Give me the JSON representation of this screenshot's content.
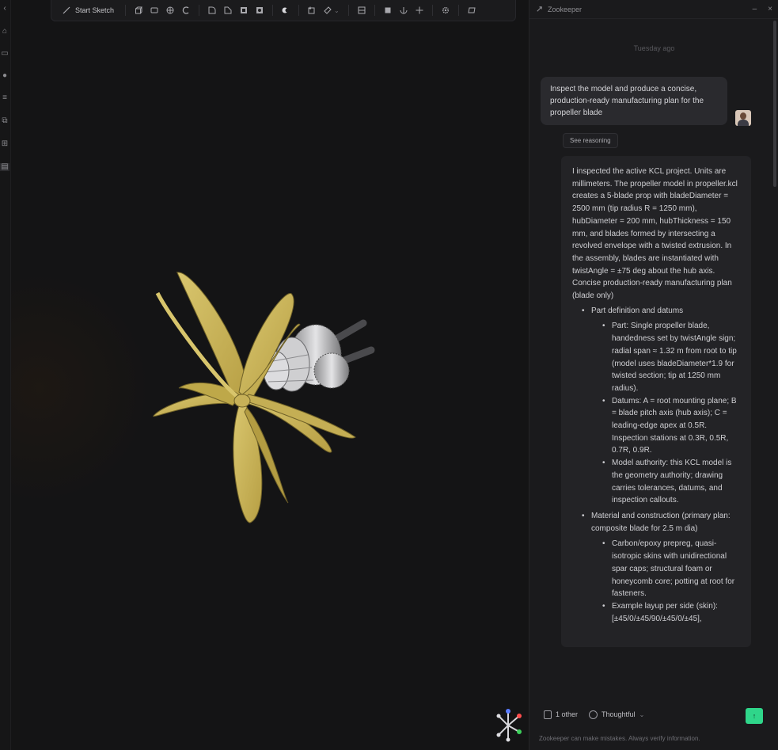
{
  "toolbar": {
    "sketch_label": "Start Sketch",
    "icons": [
      "sketch-icon",
      "extrude-icon",
      "revolve-icon",
      "sweep-icon",
      "loft-icon",
      "fillet-icon",
      "chamfer-icon",
      "shell-icon",
      "hole-icon",
      "boolean-icon",
      "plane-icon",
      "measure-icon",
      "section-icon",
      "cube-icon",
      "sphere-icon",
      "move-icon",
      "settings-icon",
      "view-icon"
    ]
  },
  "panel": {
    "title": "Zookeeper",
    "timestamp": "Tuesday ago",
    "user_message": "Inspect the model and produce a concise, production-ready manufacturing plan for the propeller blade",
    "reasoning_button": "See reasoning",
    "assistant": {
      "intro": "I inspected the active KCL project. Units are millimeters. The propeller model in propeller.kcl creates a 5-blade prop with bladeDiameter = 2500 mm (tip radius R = 1250 mm), hubDiameter = 200 mm, hubThickness = 150 mm, and blades formed by intersecting a revolved envelope with a twisted extrusion. In the assembly, blades are instantiated with twistAngle = ±75 deg about the hub axis. Concise production-ready manufacturing plan (blade only)",
      "sections": [
        {
          "title": "Part definition and datums",
          "items": [
            "Part: Single propeller blade, handedness set by twistAngle sign; radial span ≈ 1.32 m from root to tip (model uses bladeDiameter*1.9 for twisted section; tip at 1250 mm radius).",
            "Datums: A = root mounting plane; B = blade pitch axis (hub axis); C = leading-edge apex at 0.5R. Inspection stations at 0.3R, 0.5R, 0.7R, 0.9R.",
            "Model authority: this KCL model is the geometry authority; drawing carries tolerances, datums, and inspection callouts."
          ]
        },
        {
          "title": "Material and construction (primary plan: composite blade for 2.5 m dia)",
          "items": [
            "Carbon/epoxy prepreg, quasi-isotropic skins with unidirectional spar caps; structural foam or honeycomb core; potting at root for fasteners.",
            "Example layup per side (skin): [±45/0/±45/90/±45/0/±45],"
          ]
        }
      ]
    },
    "composer": {
      "attach_label": "1 other",
      "mode_label": "Thoughtful",
      "send_icon": "arrow-icon",
      "footer": "Zookeeper can make mistakes. Always verify information."
    }
  },
  "colors": {
    "blade": "#c9b25a",
    "accent_send": "#2fd68a"
  }
}
